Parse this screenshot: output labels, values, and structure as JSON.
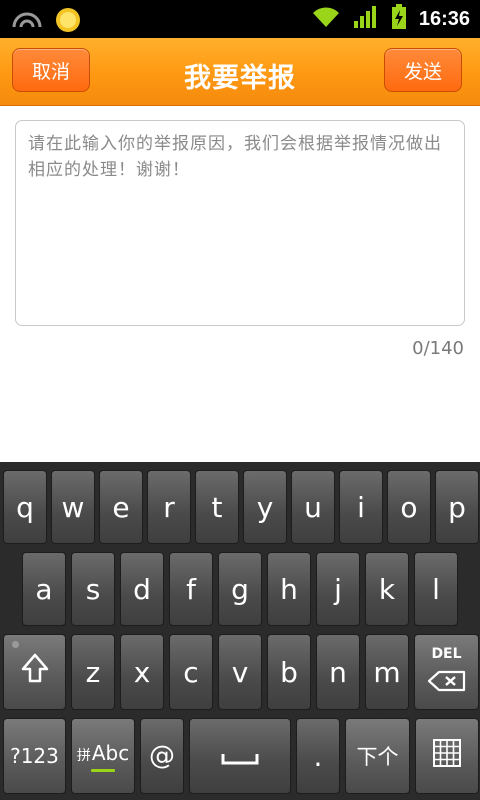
{
  "status_bar": {
    "time": "16:36",
    "icons": [
      "signal-arc-icon",
      "sun-weather-icon",
      "wifi-icon",
      "cell-signal-icon",
      "battery-charging-icon"
    ]
  },
  "header": {
    "cancel_label": "取消",
    "title": "我要举报",
    "send_label": "发送"
  },
  "report": {
    "placeholder": "请在此输入你的举报原因，我们会根据举报情况做出相应的处理！谢谢！",
    "counter": "0/140"
  },
  "keyboard": {
    "row1": [
      "q",
      "w",
      "e",
      "r",
      "t",
      "y",
      "u",
      "i",
      "o",
      "p"
    ],
    "row2": [
      "a",
      "s",
      "d",
      "f",
      "g",
      "h",
      "j",
      "k",
      "l"
    ],
    "row3": [
      "z",
      "x",
      "c",
      "v",
      "b",
      "n",
      "m"
    ],
    "del_label": "DEL",
    "numbers_label": "?123",
    "ime_label_a": "拼",
    "ime_label_b": "Abc",
    "at_label": "@",
    "dot_label": ".",
    "next_label": "下个"
  }
}
